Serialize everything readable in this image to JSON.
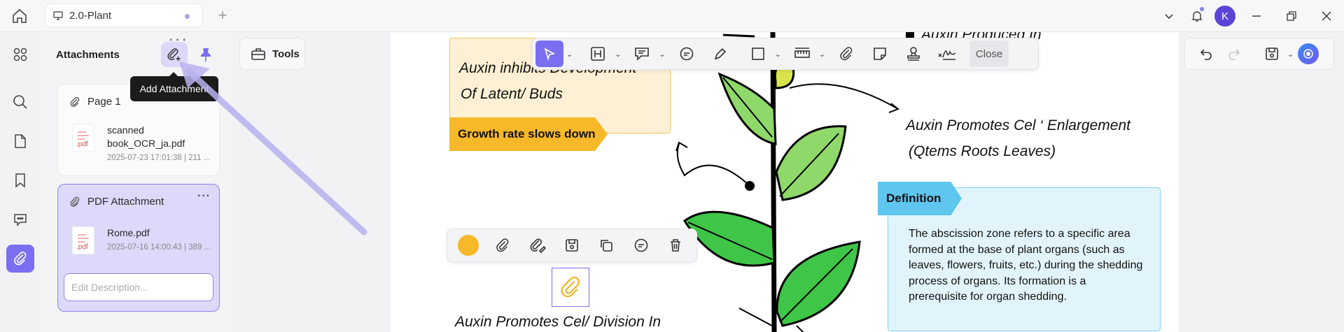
{
  "tab": {
    "title": "2.0-Plant"
  },
  "panel": {
    "title": "Attachments",
    "tooltip": "Add Attachment",
    "cards": [
      {
        "label": "Page 1",
        "file_name": "scanned book_OCR_ja.pdf",
        "file_meta": "2025-07-23 17:01:38 | 211 ...",
        "ext": ".pdf"
      },
      {
        "label": "PDF Attachment",
        "file_name": "Rome.pdf",
        "file_meta": "2025-07-16 14:00:43 | 389 ...",
        "ext": ".pdf",
        "more": "···"
      }
    ],
    "description_placeholder": "Edit Description..."
  },
  "tools": {
    "label": "Tools"
  },
  "markup_toolbar": {
    "close_label": "Close"
  },
  "document": {
    "top_cut_text": "Auxin Produced In",
    "yellow_note_line1": "Auxin inhibits Development",
    "yellow_note_line2": "Of Latent/ Buds",
    "growth_tag": "Growth rate slows down",
    "right_line1": "Auxin Promotes Cel ‘ Enlargement",
    "right_line2": "(Qtems Roots Leaves)",
    "definition_tag": "Definition",
    "definition_text": "The abscission zone refers to a specific area formed at the base of plant organs (such as leaves, flowers, fruits, etc.) during the shedding process of organs. Its formation is a prerequisite for organ shedding.",
    "bottom_text": "Auxin Promotes Cel/ Division In"
  },
  "user": {
    "avatar_initial": "K"
  },
  "colors": {
    "accent": "#7a6ff0",
    "highlight_yellow": "#f7b829",
    "definition_blue": "#5ec6ef"
  }
}
